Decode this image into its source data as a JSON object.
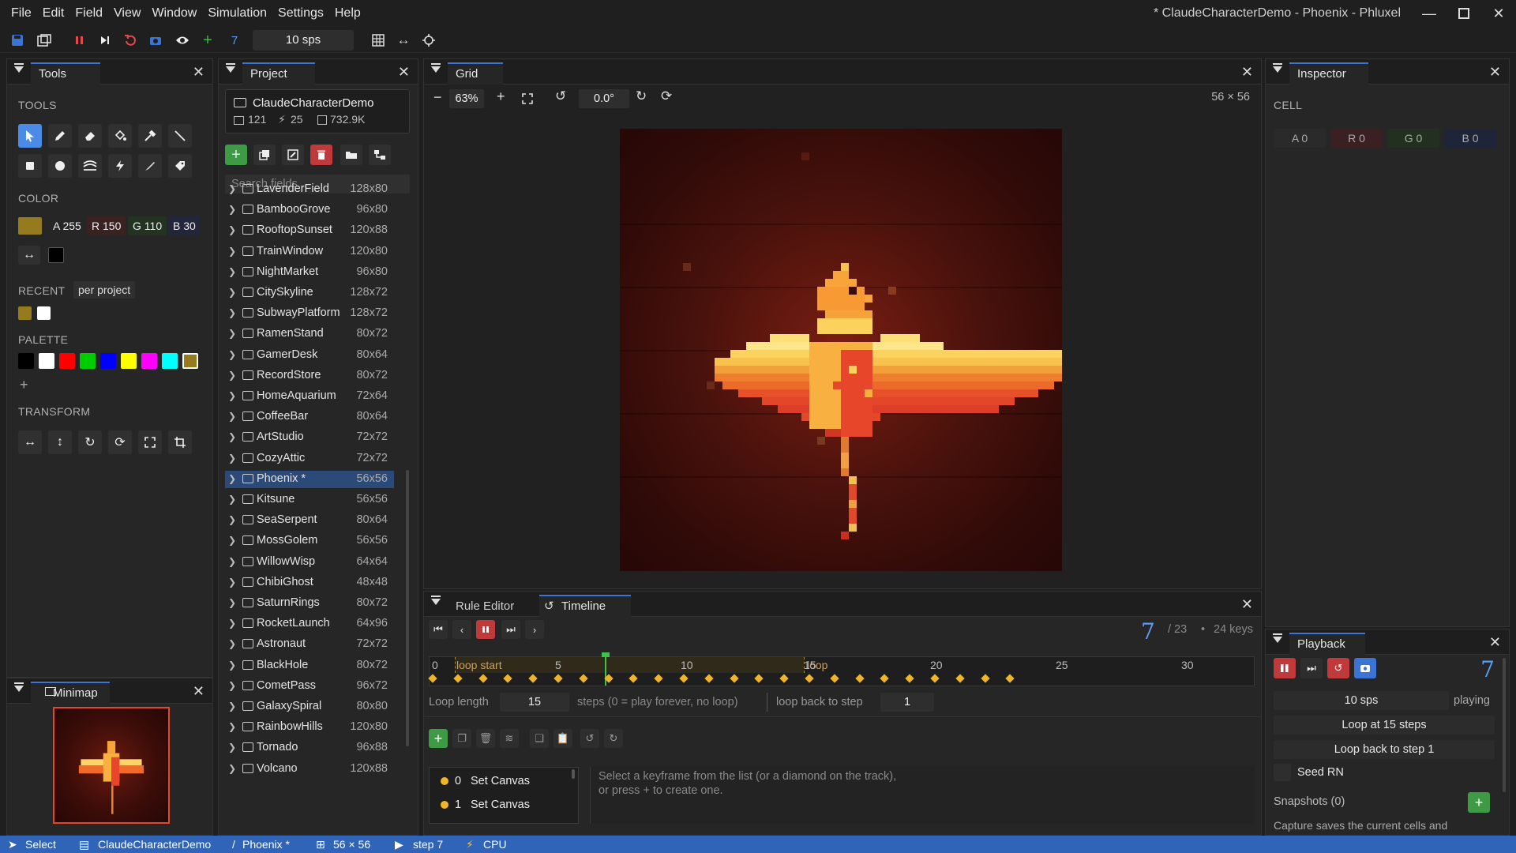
{
  "menu": [
    "File",
    "Edit",
    "Field",
    "View",
    "Window",
    "Simulation",
    "Settings",
    "Help"
  ],
  "window_title": "* ClaudeCharacterDemo - Phoenix - Phluxel",
  "toolbar": {
    "step": "7",
    "sps": "10 sps"
  },
  "tools_panel": {
    "tab": "Tools",
    "tools_label": "TOOLS",
    "color_label": "COLOR",
    "color": {
      "a": "A 255",
      "r": "R 150",
      "g": "G 110",
      "b": "B 30",
      "swatch": "#967a1e"
    },
    "recent_label": "RECENT",
    "recent_mode": "per project",
    "recent_colors": [
      "#967a1e",
      "#ffffff"
    ],
    "palette_label": "PALETTE",
    "palette": [
      "#000000",
      "#ffffff",
      "#ff0000",
      "#00cc00",
      "#0000ff",
      "#ffff00",
      "#ff00ff",
      "#00ffff",
      "#967a1e"
    ],
    "transform_label": "TRANSFORM"
  },
  "minimap": {
    "tab": "Minimap"
  },
  "project": {
    "tab": "Project",
    "name": "ClaudeCharacterDemo",
    "stats": {
      "fields": "121",
      "rules": "25",
      "size": "732.9K"
    },
    "search_placeholder": "Search fields...",
    "fields": [
      {
        "name": "LavenderField",
        "size": "128x80"
      },
      {
        "name": "BambooGrove",
        "size": "96x80"
      },
      {
        "name": "RooftopSunset",
        "size": "120x88"
      },
      {
        "name": "TrainWindow",
        "size": "120x80"
      },
      {
        "name": "NightMarket",
        "size": "96x80"
      },
      {
        "name": "CitySkyline",
        "size": "128x72"
      },
      {
        "name": "SubwayPlatform",
        "size": "128x72"
      },
      {
        "name": "RamenStand",
        "size": "80x72"
      },
      {
        "name": "GamerDesk",
        "size": "80x64"
      },
      {
        "name": "RecordStore",
        "size": "80x72"
      },
      {
        "name": "HomeAquarium",
        "size": "72x64"
      },
      {
        "name": "CoffeeBar",
        "size": "80x64"
      },
      {
        "name": "ArtStudio",
        "size": "72x72"
      },
      {
        "name": "CozyAttic",
        "size": "72x72"
      },
      {
        "name": "Phoenix  *",
        "size": "56x56",
        "selected": true
      },
      {
        "name": "Kitsune",
        "size": "56x56"
      },
      {
        "name": "SeaSerpent",
        "size": "80x64"
      },
      {
        "name": "MossGolem",
        "size": "56x56"
      },
      {
        "name": "WillowWisp",
        "size": "64x64"
      },
      {
        "name": "ChibiGhost",
        "size": "48x48"
      },
      {
        "name": "SaturnRings",
        "size": "80x72"
      },
      {
        "name": "RocketLaunch",
        "size": "64x96"
      },
      {
        "name": "Astronaut",
        "size": "72x72"
      },
      {
        "name": "BlackHole",
        "size": "80x72"
      },
      {
        "name": "CometPass",
        "size": "96x72"
      },
      {
        "name": "GalaxySpiral",
        "size": "80x80"
      },
      {
        "name": "RainbowHills",
        "size": "120x80"
      },
      {
        "name": "Tornado",
        "size": "96x88"
      },
      {
        "name": "Volcano",
        "size": "120x88"
      }
    ]
  },
  "grid": {
    "tab": "Grid",
    "zoom": "63%",
    "rotation": "0.0°",
    "dims": "56 × 56"
  },
  "inspector": {
    "tab": "Inspector",
    "cell_label": "CELL",
    "a": "A 0",
    "r": "R 0",
    "g": "G 0",
    "b": "B 0"
  },
  "timeline": {
    "tabs": [
      "Rule Editor",
      "Timeline"
    ],
    "step": "7",
    "total": "/ 23",
    "keys": "24 keys",
    "ticks": [
      "0",
      "5",
      "10",
      "15",
      "20",
      "25",
      "30"
    ],
    "loop_start_label": "loop start",
    "loop_end_label": "loop",
    "loop_length_label": "Loop length",
    "loop_length": "15",
    "steps_hint": "steps  (0 = play forever, no loop)",
    "loop_back_label": "loop back to step",
    "loop_back": "1",
    "keyframes": [
      {
        "idx": "0",
        "name": "Set Canvas"
      },
      {
        "idx": "1",
        "name": "Set Canvas"
      }
    ],
    "hint_line1": "Select a keyframe from the list (or a diamond on the track),",
    "hint_line2": "or press + to create one."
  },
  "playback": {
    "tab": "Playback",
    "step": "7",
    "sps": "10 sps",
    "state": "playing",
    "loop_at": "Loop at 15 steps",
    "loop_back": "Loop back to step 1",
    "seed": "Seed RN",
    "snapshots": "Snapshots (0)",
    "capture_hint": "Capture saves the current cells and"
  },
  "status": {
    "tool": "Select",
    "project": "ClaudeCharacterDemo",
    "sep": "/",
    "field": "Phoenix *",
    "dims": "56 × 56",
    "step": "step 7",
    "backend": "CPU"
  },
  "colors": {
    "accent": "#3b74d4",
    "status": "#2f64b8",
    "keyframe": "#f0b428",
    "danger": "#c0393b"
  }
}
